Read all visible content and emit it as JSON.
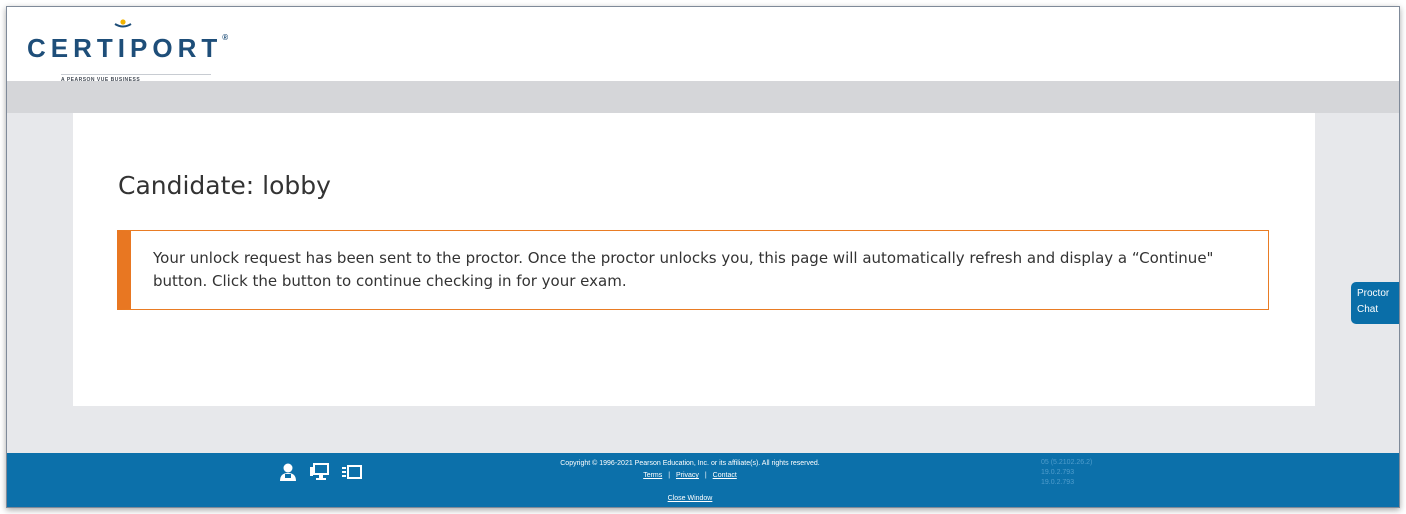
{
  "brand": {
    "logo_text": "CERTIPORT",
    "tagline": "A PEARSON VUE BUSINESS",
    "primary_color": "#1e4e79",
    "accent_color": "#e87722",
    "footer_color": "#0c70aa"
  },
  "main": {
    "title": "Candidate: lobby",
    "alert_message": "Your unlock request has been sent to the proctor. Once the proctor unlocks you, this page will automatically refresh and display a “Continue\" button. Click the button to continue checking in for your exam."
  },
  "proctor_chat": {
    "line1": "Proctor",
    "line2": "Chat"
  },
  "footer": {
    "icons": [
      "proctor-icon",
      "computer-icon",
      "window-layout-icon"
    ],
    "copyright": "Copyright © 1996-2021 Pearson Education, Inc. or its affiliate(s). All rights reserved.",
    "links": {
      "terms": "Terms",
      "privacy": "Privacy",
      "contact": "Contact"
    },
    "separator": "|",
    "close_window": "Close Window",
    "versions": [
      "05 (5.2102.26.2)",
      "19.0.2.793",
      "19.0.2.793"
    ]
  }
}
